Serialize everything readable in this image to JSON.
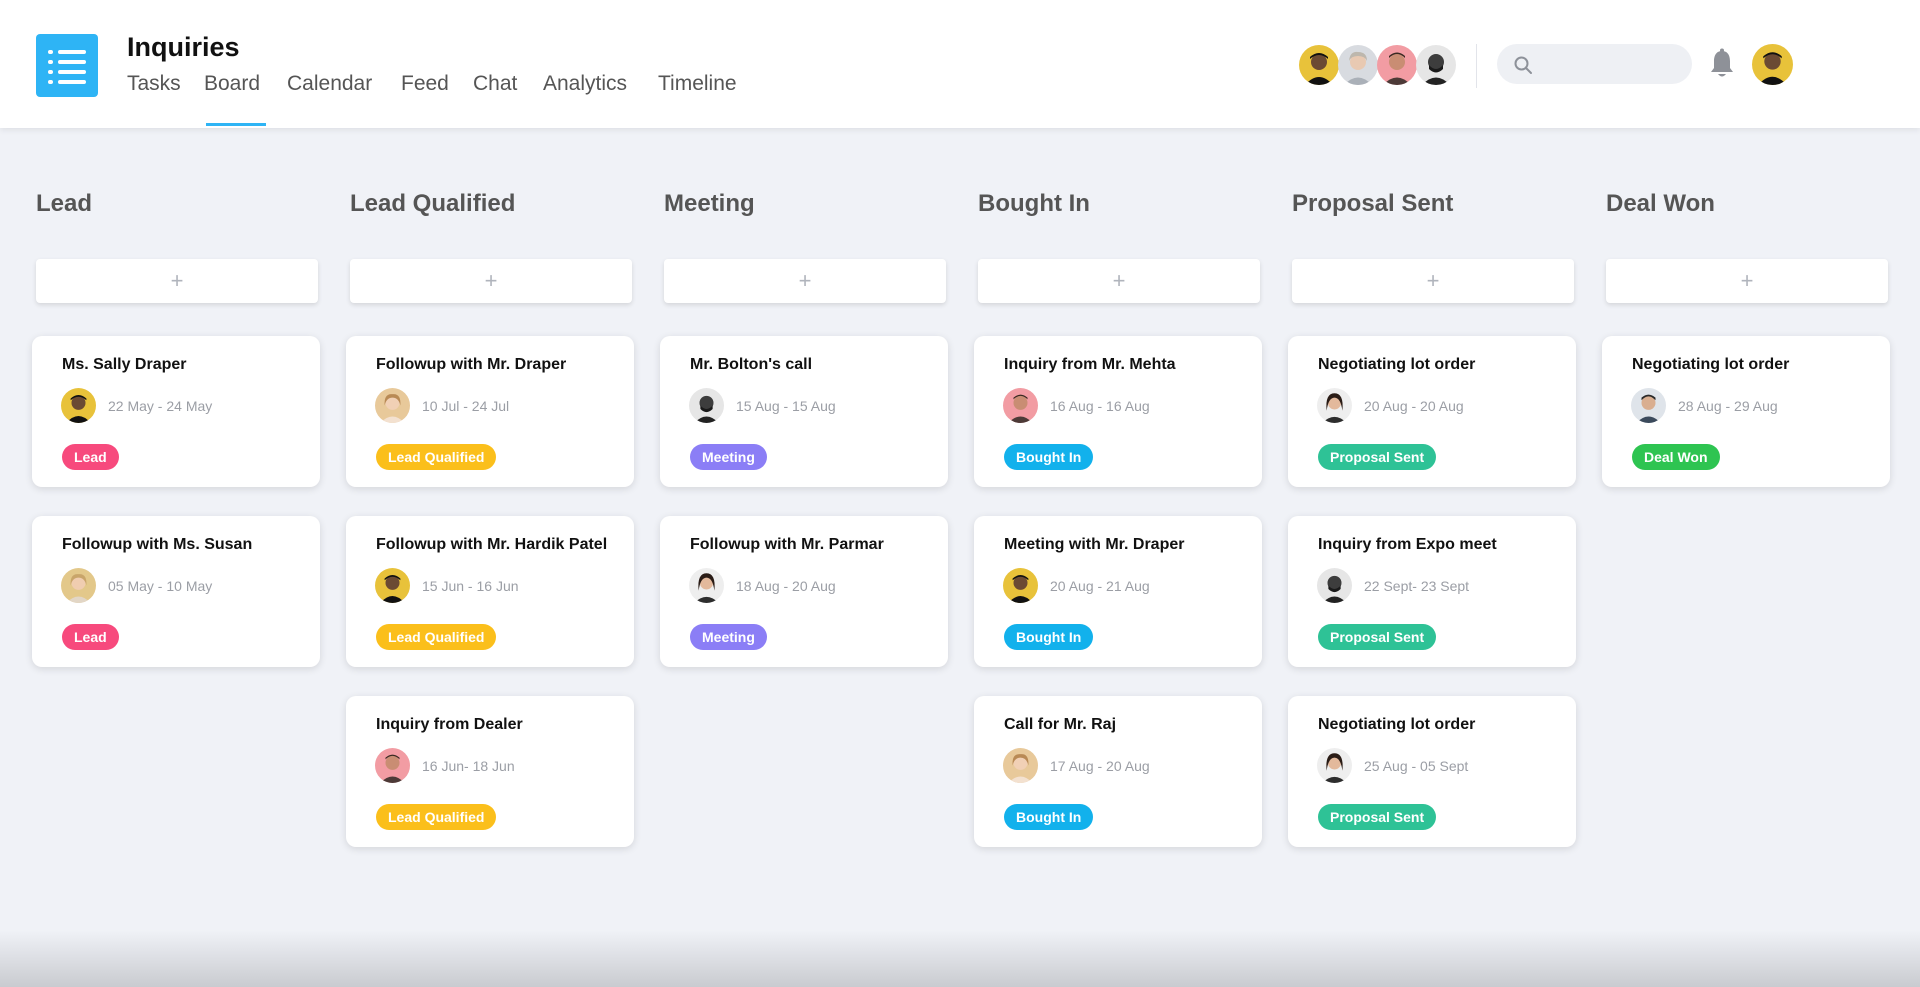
{
  "header": {
    "title": "Inquiries",
    "tabs": [
      {
        "label": "Tasks",
        "active": false
      },
      {
        "label": "Board",
        "active": true
      },
      {
        "label": "Calendar",
        "active": false
      },
      {
        "label": "Feed",
        "active": false
      },
      {
        "label": "Chat",
        "active": false
      },
      {
        "label": "Analytics",
        "active": false
      },
      {
        "label": "Timeline",
        "active": false
      }
    ],
    "search": {
      "placeholder": "",
      "value": ""
    },
    "icons": {
      "logo": "list-icon",
      "search": "search-icon",
      "notifications": "bell-icon"
    }
  },
  "colors": {
    "accent": "#2eb4f5",
    "lead": "#f74a7d",
    "lead_qualified": "#fbbf1b",
    "meeting": "#8b7ef6",
    "bought_in": "#12b1ec",
    "proposal_sent": "#2ec296",
    "deal_won": "#2ec451"
  },
  "board": {
    "add_label": "+",
    "columns": [
      {
        "title": "Lead",
        "cards": [
          {
            "title": "Ms. Sally Draper",
            "date": "22 May - 24 May",
            "tag": "Lead"
          },
          {
            "title": "Followup with Ms. Susan",
            "date": "05 May - 10 May",
            "tag": "Lead"
          }
        ]
      },
      {
        "title": "Lead Qualified",
        "cards": [
          {
            "title": "Followup with Mr. Draper",
            "date": "10 Jul - 24 Jul",
            "tag": "Lead Qualified"
          },
          {
            "title": "Followup with Mr. Hardik Patel",
            "date": "15 Jun - 16 Jun",
            "tag": "Lead Qualified"
          },
          {
            "title": "Inquiry from Dealer",
            "date": "16 Jun- 18 Jun",
            "tag": "Lead Qualified"
          }
        ]
      },
      {
        "title": "Meeting",
        "cards": [
          {
            "title": "Mr. Bolton's call",
            "date": "15 Aug - 15 Aug",
            "tag": "Meeting"
          },
          {
            "title": "Followup with Mr. Parmar",
            "date": "18 Aug - 20 Aug",
            "tag": "Meeting"
          }
        ]
      },
      {
        "title": "Bought In",
        "cards": [
          {
            "title": "Inquiry from Mr. Mehta",
            "date": "16 Aug - 16 Aug",
            "tag": "Bought In"
          },
          {
            "title": "Meeting with Mr. Draper",
            "date": "20 Aug - 21 Aug",
            "tag": "Bought In"
          },
          {
            "title": "Call for Mr. Raj",
            "date": "17 Aug - 20 Aug",
            "tag": "Bought In"
          }
        ]
      },
      {
        "title": "Proposal Sent",
        "cards": [
          {
            "title": "Negotiating lot order",
            "date": "20 Aug - 20 Aug",
            "tag": "Proposal Sent"
          },
          {
            "title": "Inquiry from Expo meet",
            "date": "22 Sept- 23 Sept",
            "tag": "Proposal Sent"
          },
          {
            "title": "Negotiating lot order",
            "date": "25 Aug - 05 Sept",
            "tag": "Proposal Sent"
          }
        ]
      },
      {
        "title": "Deal Won",
        "cards": [
          {
            "title": "Negotiating lot order",
            "date": "28 Aug - 29 Aug",
            "tag": "Deal Won"
          }
        ]
      }
    ]
  }
}
